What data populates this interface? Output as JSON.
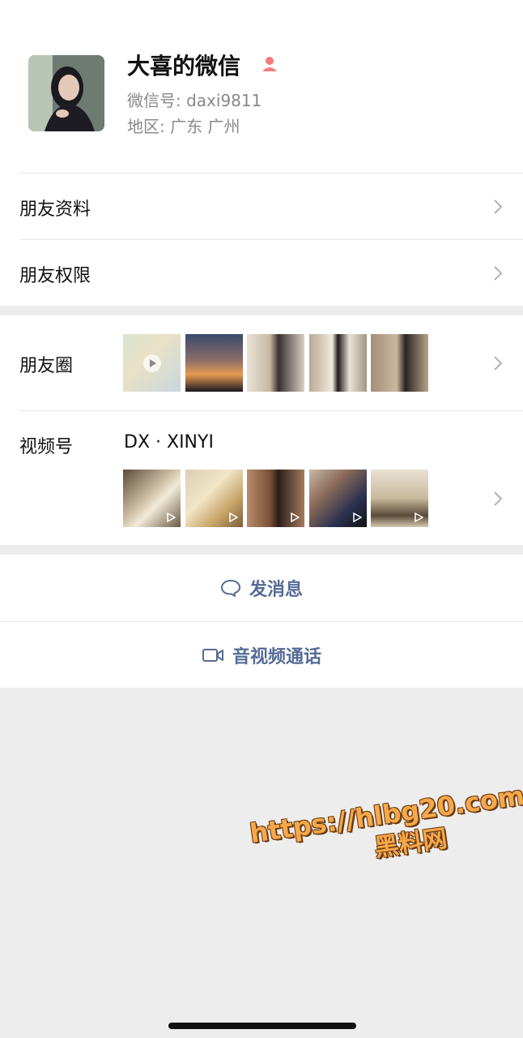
{
  "profile": {
    "name": "大喜的微信",
    "wechat_id": "微信号: daxi9811",
    "region": "地区: 广东 广州",
    "gender_icon": "female-icon",
    "gender_color": "#f37b7d"
  },
  "rows": {
    "friend_info": "朋友资料",
    "friend_permissions": "朋友权限",
    "moments": "朋友圈",
    "channels": "视频号",
    "channels_name": "DX · XINYI"
  },
  "actions": {
    "send_message": "发消息",
    "video_call": "音视频通话",
    "accent": "#576b95"
  },
  "watermark": {
    "line1": "https://hlbg20.com",
    "line2": "黑料网"
  }
}
